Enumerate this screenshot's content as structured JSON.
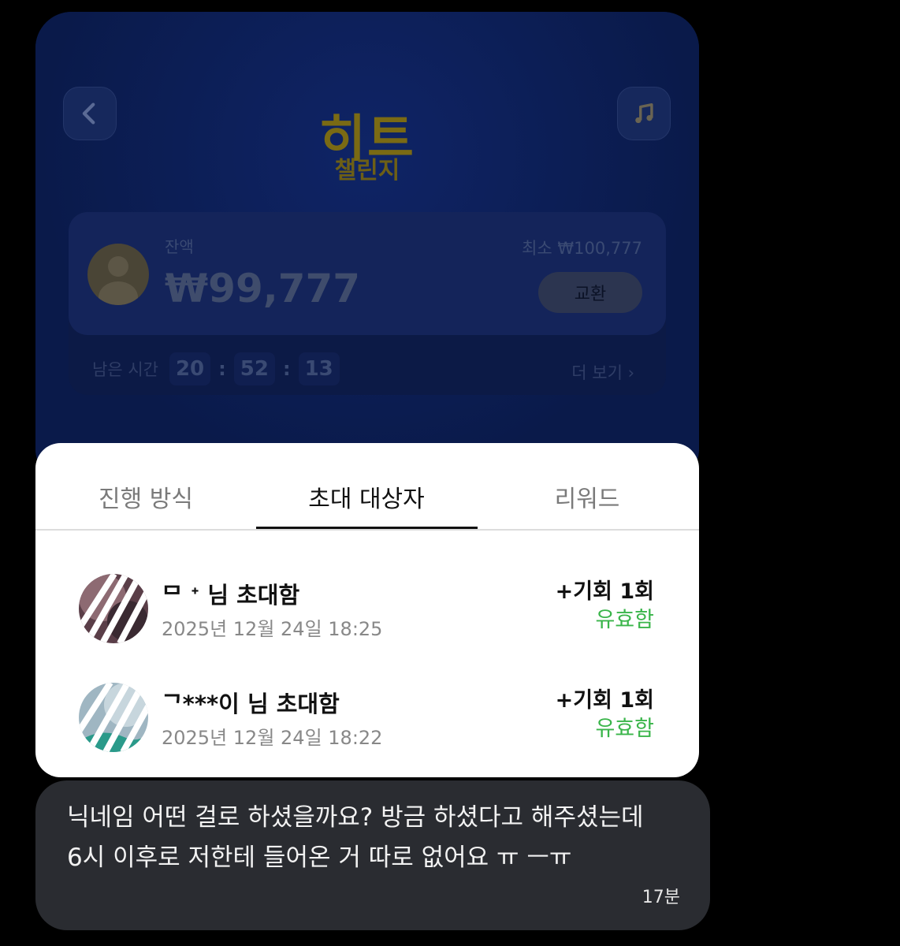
{
  "app": {
    "title": "히트",
    "subtitle": "챌린지",
    "back_icon": "chevron-left-icon",
    "music_icon": "music-note-icon",
    "colors": {
      "card_bg": "#0a1a4a",
      "title_gold": "#7a6a14"
    }
  },
  "balance": {
    "label": "잔액",
    "amount": "₩99,777",
    "minimum": "최소  ₩100,777",
    "exchange_label": "교환"
  },
  "timer": {
    "label": "남은 시간",
    "hours": "20",
    "minutes": "52",
    "seconds": "13",
    "separator": ":"
  },
  "more_label": "더 보기 ›",
  "tabs": [
    {
      "label": "진행 방식",
      "active": false
    },
    {
      "label": "초대 대상자",
      "active": true
    },
    {
      "label": "리워드",
      "active": false
    }
  ],
  "invites": [
    {
      "name": "ᄆ    ᐩ 님 초대함",
      "date": "2025년 12월 24일 18:25",
      "bonus": "+기회 1회",
      "status": "유효함"
    },
    {
      "name": "ᄀ***이 님 초대함",
      "date": "2025년 12월 24일 18:22",
      "bonus": "+기회 1회",
      "status": "유효함"
    }
  ],
  "status_color": "#3ab54a",
  "message": {
    "text": "닉네임 어떤 걸로 하셨을까요? 방금 하셨다고 해주셨는데 6시 이후로 저한테 들어온 거 따로 없어요 ㅠ ㅡㅠ",
    "time": "17분"
  }
}
